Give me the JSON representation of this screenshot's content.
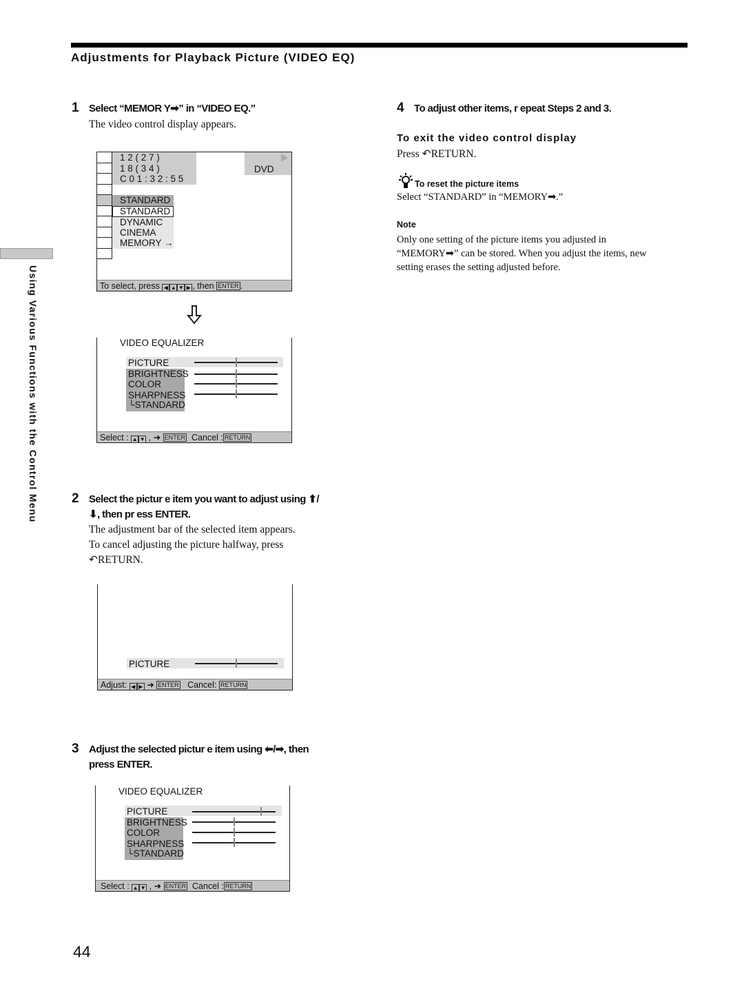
{
  "header": {
    "section_title": "Adjustments for Playback Picture (VIDEO EQ)"
  },
  "side_tab": {
    "label": "Using Various Functions with the Control Menu"
  },
  "steps": [
    {
      "num": "1",
      "heading": "Select “MEMOR  Y➡” in “VIDEO EQ.”",
      "body": [
        "The video control display appears."
      ]
    },
    {
      "num": "2",
      "heading": [
        "Select the pictur   e item you want to adjust using   ⬆/",
        "⬇, then pr  ess ENTER."
      ],
      "body": [
        "The adjustment bar of the selected item appears.",
        "To cancel adjusting the picture halfway, press",
        "↶RETURN."
      ]
    },
    {
      "num": "3",
      "heading": [
        "Adjust the selected pictur    e item using   ⬅/➡, then",
        "press ENTER."
      ]
    },
    {
      "num": "4",
      "heading": "To adjust other items, r    epeat Steps 2 and 3."
    }
  ],
  "control_display": {
    "title_chapter": "1 2 ( 2 7 )",
    "chapter": "1 8 ( 3 4 )",
    "time": "C   0 1 : 3 2 : 5 5",
    "play_icon": "play-icon",
    "disc": "DVD",
    "selected": "STANDARD",
    "options": [
      "STANDARD",
      "DYNAMIC",
      "CINEMA",
      "MEMORY →"
    ],
    "hint_prefix": "To select, press",
    "hint_keys": [
      "◀",
      "▲",
      "▼",
      "▶"
    ],
    "hint_then": ", then",
    "enter": "ENTER"
  },
  "equalizer": {
    "title": "VIDEO EQUALIZER",
    "items": [
      "PICTURE",
      "BRIGHTNESS",
      "COLOR",
      "SHARPNESS",
      "└STANDARD"
    ],
    "select_label": "Select :",
    "cancel_label": "Cancel :",
    "enter": "ENTER",
    "return": "RETURN",
    "up": "▲",
    "down": "▼",
    "arrow": "➜",
    "levels_step1": [
      0.5,
      0.5,
      0.5,
      0.5
    ],
    "levels_step3": [
      0.83,
      0.5,
      0.5,
      0.5
    ]
  },
  "adjust_screen": {
    "item": "PICTURE",
    "level": 0.5,
    "adjust_label": "Adjust:",
    "left": "◀",
    "right": "▶",
    "arrow": "➜",
    "enter": "ENTER",
    "cancel_label": "Cancel:",
    "return": "RETURN"
  },
  "right": {
    "exit_heading": "To exit the video control display",
    "exit_body": "Press ↶RETURN.",
    "tip_heading": "To reset the picture items",
    "tip_body": "Select “STANDARD” in “MEMORY➡.”",
    "note_heading": "Note",
    "note_body": [
      "Only one setting of the picture items you adjusted in",
      "“MEMORY➡” can be stored.  When you adjust the items, new",
      "setting erases the setting adjusted before."
    ]
  },
  "page_number": "44"
}
